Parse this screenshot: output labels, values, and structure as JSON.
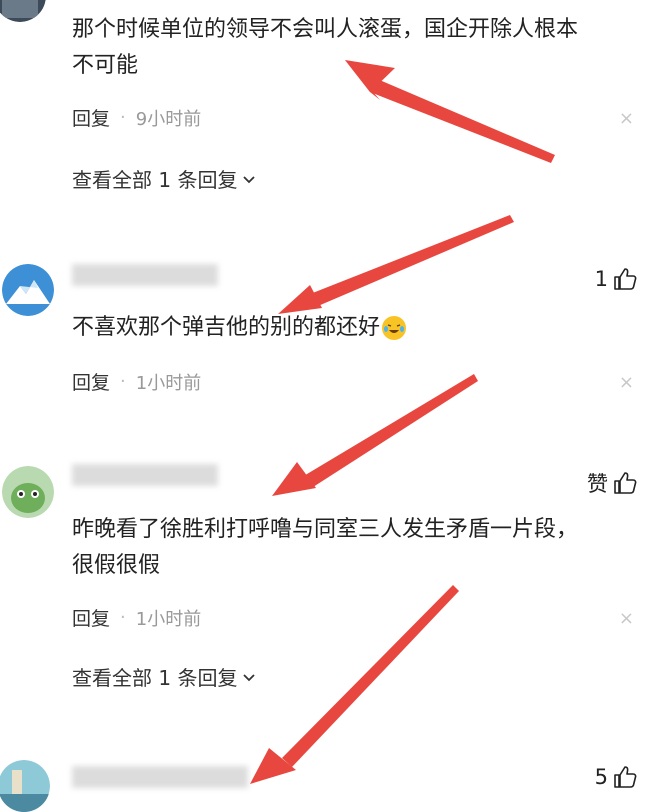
{
  "comments": [
    {
      "text_lines": [
        "那个时候单位的领导不会叫人滚蛋，国企开除人根本",
        "不可能"
      ],
      "reply_label": "回复",
      "time": "9小时前",
      "view_all": "查看全部 1 条回复"
    },
    {
      "likes": "1",
      "text": "不喜欢那个弹吉他的别的都还好",
      "emoji": "laughing-crying-emoji",
      "reply_label": "回复",
      "time": "1小时前"
    },
    {
      "likes": "赞",
      "text_lines": [
        "昨晚看了徐胜利打呼噜与同室三人发生矛盾一片段，",
        "很假很假"
      ],
      "reply_label": "回复",
      "time": "1小时前",
      "view_all": "查看全部 1 条回复"
    },
    {
      "likes": "5"
    }
  ],
  "separator": "·",
  "close_symbol": "×",
  "colors": {
    "arrow": "#e8473f",
    "meta": "#999999",
    "text": "#222222"
  }
}
